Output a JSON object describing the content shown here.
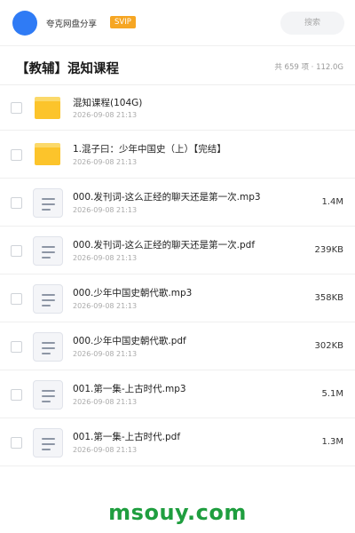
{
  "header": {
    "username": "夸克网盘分享",
    "badge": "SVIP",
    "search_placeholder": "搜索"
  },
  "folder": {
    "title": "【教辅】混知课程",
    "meta": "共 659 项 · 112.0G"
  },
  "files": [
    {
      "name": "混知课程(104G)",
      "date": "2026-09-08 21:13",
      "size": "",
      "type": "folder"
    },
    {
      "name": "1.混子曰：少年中国史（上）【完结】",
      "date": "2026-09-08 21:13",
      "size": "",
      "type": "folder"
    },
    {
      "name": "000.发刊词-这么正经的聊天还是第一次.mp3",
      "date": "2026-09-08 21:13",
      "size": "1.4M",
      "type": "file"
    },
    {
      "name": "000.发刊词-这么正经的聊天还是第一次.pdf",
      "date": "2026-09-08 21:13",
      "size": "239KB",
      "type": "file"
    },
    {
      "name": "000.少年中国史朝代歌.mp3",
      "date": "2026-09-08 21:13",
      "size": "358KB",
      "type": "file"
    },
    {
      "name": "000.少年中国史朝代歌.pdf",
      "date": "2026-09-08 21:13",
      "size": "302KB",
      "type": "file"
    },
    {
      "name": "001.第一集-上古时代.mp3",
      "date": "2026-09-08 21:13",
      "size": "5.1M",
      "type": "file"
    },
    {
      "name": "001.第一集-上古时代.pdf",
      "date": "2026-09-08 21:13",
      "size": "1.3M",
      "type": "file"
    }
  ],
  "watermark": "msouy.com",
  "colors": {
    "avatar": "#2f7bf5",
    "badge": "#f6a623",
    "folder": "#fcc42b",
    "watermark": "#1f9e3f"
  },
  "icons": {
    "folder": "folder-icon",
    "file": "document-icon",
    "checkbox": "checkbox-icon"
  }
}
